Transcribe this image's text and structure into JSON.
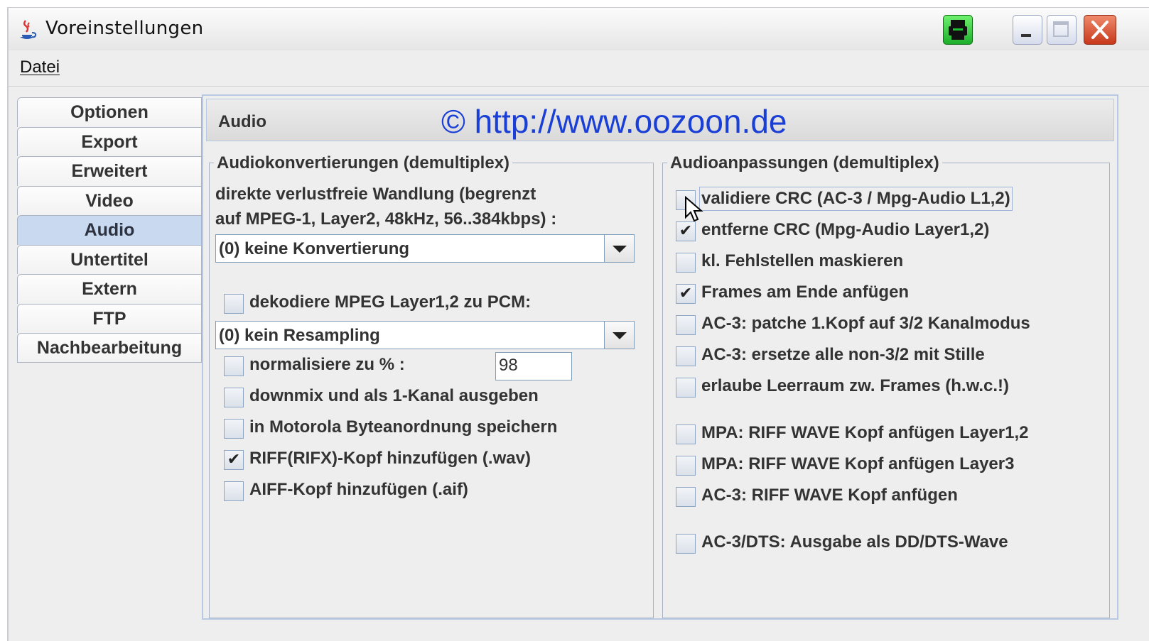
{
  "window": {
    "title": "Voreinstellungen",
    "icon": "java-cup-icon"
  },
  "titlebar_buttons": [
    "printer-icon",
    "minimize-icon",
    "maximize-icon",
    "close-icon"
  ],
  "menu": {
    "datei": "Datei"
  },
  "tabs": [
    {
      "label": "Optionen",
      "selected": false
    },
    {
      "label": "Export",
      "selected": false
    },
    {
      "label": "Erweitert",
      "selected": false
    },
    {
      "label": "Video",
      "selected": false
    },
    {
      "label": "Audio",
      "selected": true
    },
    {
      "label": "Untertitel",
      "selected": false
    },
    {
      "label": "Extern",
      "selected": false
    },
    {
      "label": "FTP",
      "selected": false
    },
    {
      "label": "Nachbearbeitung",
      "selected": false
    }
  ],
  "panel": {
    "title": "Audio",
    "watermark": "© http://www.oozoon.de"
  },
  "left_group": {
    "title": "Audiokonvertierungen (demultiplex)",
    "desc_line1": "direkte verlustfreie Wandlung (begrenzt",
    "desc_line2": "auf MPEG-1, Layer2, 48kHz, 56..384kbps) :",
    "conversion_combo": "(0) keine Konvertierung",
    "decode_checkbox": {
      "label": "dekodiere MPEG Layer1,2 zu PCM:",
      "checked": false
    },
    "resample_combo": "(0) kein Resampling",
    "normalize": {
      "label": "normalisiere zu % :",
      "checked": false,
      "value": "98"
    },
    "downmix": {
      "label": "downmix und als 1-Kanal ausgeben",
      "checked": false
    },
    "motorola": {
      "label": "in Motorola Byteanordnung speichern",
      "checked": false
    },
    "riff": {
      "label": "RIFF(RIFX)-Kopf hinzufügen (.wav)",
      "checked": true
    },
    "aiff": {
      "label": "AIFF-Kopf hinzufügen (.aif)",
      "checked": false
    }
  },
  "right_group": {
    "title": "Audioanpassungen (demultiplex)",
    "items": [
      {
        "label": "validiere CRC (AC-3 / Mpg-Audio L1,2)",
        "checked": false
      },
      {
        "label": "entferne CRC (Mpg-Audio Layer1,2)",
        "checked": true
      },
      {
        "label": "kl. Fehlstellen maskieren",
        "checked": false
      },
      {
        "label": "Frames am Ende anfügen",
        "checked": true
      },
      {
        "label": "AC-3: patche 1.Kopf auf 3/2 Kanalmodus",
        "checked": false
      },
      {
        "label": "AC-3: ersetze alle non-3/2 mit Stille",
        "checked": false
      },
      {
        "label": "erlaube Leerraum zw. Frames (h.w.c.!)",
        "checked": false
      },
      {
        "label": "MPA: RIFF WAVE Kopf anfügen Layer1,2",
        "checked": false
      },
      {
        "label": "MPA: RIFF WAVE Kopf anfügen Layer3",
        "checked": false
      },
      {
        "label": "AC-3: RIFF WAVE Kopf anfügen",
        "checked": false
      },
      {
        "label": "AC-3/DTS: Ausgabe als DD/DTS-Wave",
        "checked": false
      }
    ]
  },
  "check_glyph": "✔"
}
